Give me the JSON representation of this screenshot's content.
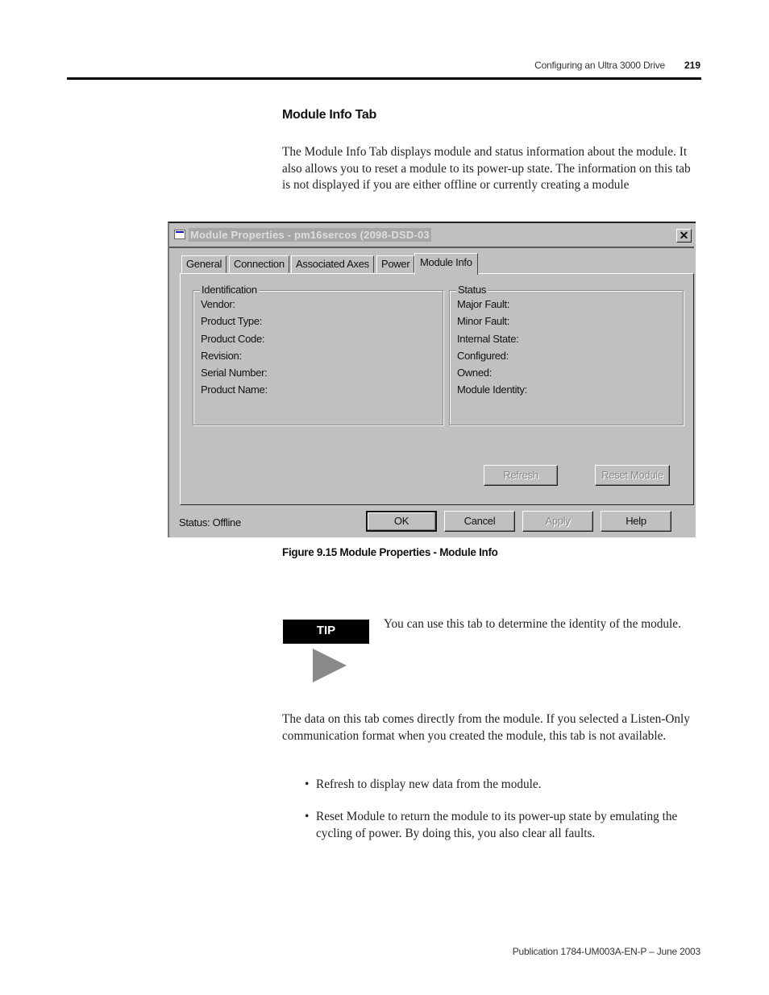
{
  "header": {
    "section_title": "Configuring an Ultra 3000 Drive",
    "page_number": "219"
  },
  "heading": "Module Info Tab",
  "intro_paragraph": "The Module Info Tab displays module and status information about the module. It also allows you to reset a module to its power-up state. The information on this tab is not displayed if you are either offline or currently creating a module",
  "dialog": {
    "title": "Module Properties - pm16sercos (2098-DSD-03",
    "close_label": "✕",
    "tabs": [
      {
        "label": "General",
        "active": false
      },
      {
        "label": "Connection",
        "active": false
      },
      {
        "label": "Associated Axes",
        "active": false
      },
      {
        "label": "Power",
        "active": false
      },
      {
        "label": "Module Info",
        "active": true
      }
    ],
    "identification": {
      "title": "Identification",
      "fields": [
        "Vendor:",
        "Product Type:",
        "Product Code:",
        "Revision:",
        "Serial Number:",
        "Product Name:"
      ]
    },
    "status_group": {
      "title": "Status",
      "fields": [
        "Major Fault:",
        "Minor Fault:",
        "Internal State:",
        "Configured:",
        "Owned:",
        "Module Identity:"
      ]
    },
    "refresh_label": "Refresh",
    "reset_module_label": "Reset Module",
    "status_text": "Status:  Offline",
    "buttons": {
      "ok": "OK",
      "cancel": "Cancel",
      "apply": "Apply",
      "help": "Help"
    }
  },
  "figure_caption": "Figure 9.15 Module Properties - Module Info",
  "tip": {
    "label": "TIP",
    "text": "You can use this tab to determine the identity of the module."
  },
  "body_paragraph": "The data on this tab comes directly from the module. If you selected a Listen-Only communication format when you created the module, this tab is not available.",
  "bullets": [
    "Refresh to display new data from the module.",
    "Reset Module to return the module to its power-up state by emulating the cycling of power. By doing this, you also clear all faults."
  ],
  "footer": "Publication 1784-UM003A-EN-P – June 2003"
}
